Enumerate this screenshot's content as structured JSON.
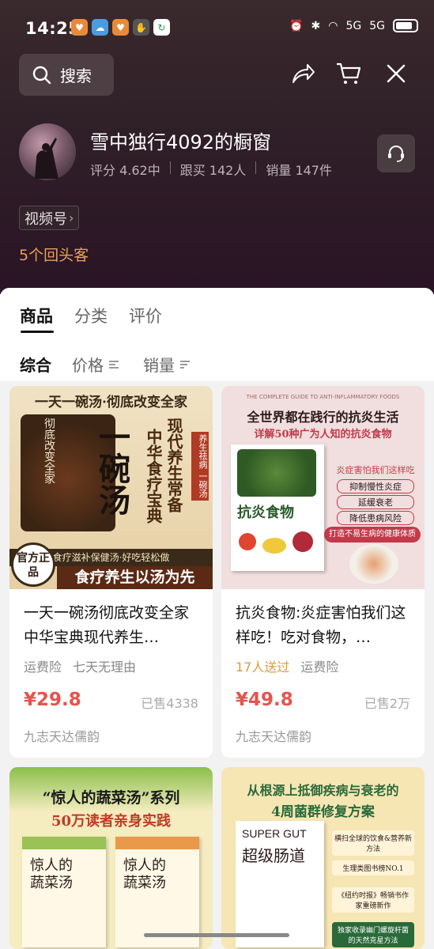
{
  "status": {
    "time": "14:25",
    "net1": "5G",
    "net2": "5G"
  },
  "header": {
    "search_label": "搜索"
  },
  "shop": {
    "title": "雪中独行4092的橱窗",
    "rating": "评分 4.62中",
    "followers": "跟买 142人",
    "sales": "销量 147件",
    "channel": "视频号",
    "returners": "5个回头客"
  },
  "tabs": [
    "商品",
    "分类",
    "评价"
  ],
  "sort": [
    "综合",
    "价格",
    "销量"
  ],
  "products": [
    {
      "title": "一天一碗汤彻底改变全家 中华宝典现代养生…",
      "tags": [
        "运费险",
        "七天无理由"
      ],
      "price": "¥29.8",
      "sold": "已售4338",
      "shop": "九志天达儒韵",
      "art": {
        "banner": "一天一碗汤·彻底改变全家",
        "big": "一碗汤",
        "sub1": "中华食疗宝典",
        "sub2": "现代养生常备",
        "side": "养生祛病 一碗汤",
        "official": "官方正品",
        "slogan1": "食疗滋补保健汤·好吃轻松做",
        "slogan2": "食疗养生以汤为先",
        "vertical": "彻底改变全家"
      }
    },
    {
      "title": "抗炎食物:炎症害怕我们这样吃！吃对食物，…",
      "tags": [
        "17人送过",
        "运费险"
      ],
      "price": "¥49.8",
      "sold": "已售2万",
      "shop": "九志天达儒韵",
      "art": {
        "eng": "THE COMPLETE GUIDE TO ANTI-INFLAMMATORY FOODS",
        "line1": "全世界都在践行的抗炎生活",
        "line2": "详解50种广为人知的抗炎食物",
        "book": "抗炎食物",
        "q": "炎症害怕我们这样吃",
        "p1": "抑制慢性炎症",
        "p2": "延缓衰老",
        "p3": "降低患病风险",
        "bar": "打造不易生病的健康体质"
      }
    },
    {
      "art": {
        "line1": "“惊人的蔬菜汤”系列",
        "line2": "50万读者亲身实践",
        "book1": "惊人的蔬菜汤",
        "book2": "惊人的蔬菜汤"
      }
    },
    {
      "art": {
        "line1": "从根源上抵御疾病与衰老的",
        "line2": "4周菌群修复方案",
        "eng": "SUPER GUT",
        "book": "超级肠道",
        "b1": "横扫全球的饮食&营养新方法",
        "b2": "生理类图书榜NO.1",
        "b3": "《纽约时报》畅销书作家重磅新作",
        "b4": "独家收录幽门螺旋杆菌的天然克星方法"
      }
    }
  ]
}
